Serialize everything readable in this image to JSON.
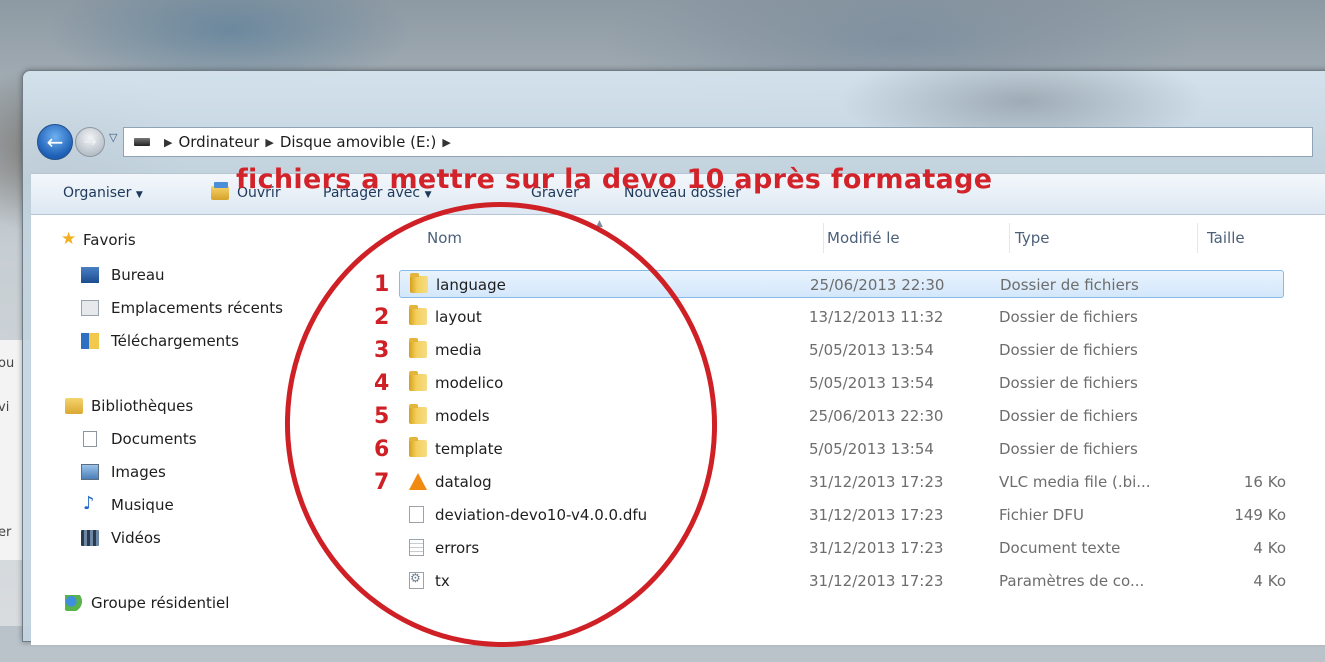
{
  "address_bar": {
    "breadcrumbs": [
      "Ordinateur",
      "Disque amovible (E:)"
    ]
  },
  "toolbar": {
    "organize": "Organiser",
    "open": "Ouvrir",
    "share": "Partager avec",
    "burn": "Graver",
    "new_folder": "Nouveau dossier"
  },
  "annotation": {
    "title": "fichiers a mettre sur la devo 10 après formatage",
    "numbers": [
      "1",
      "2",
      "3",
      "4",
      "5",
      "6",
      "7"
    ],
    "color": "#d2232a"
  },
  "behind_window": [
    "ou",
    "vi",
    "er"
  ],
  "sidebar": {
    "favorites": {
      "label": "Favoris",
      "items": [
        "Bureau",
        "Emplacements récents",
        "Téléchargements"
      ]
    },
    "libraries": {
      "label": "Bibliothèques",
      "items": [
        "Documents",
        "Images",
        "Musique",
        "Vidéos"
      ]
    },
    "homegroup": "Groupe résidentiel"
  },
  "columns": {
    "name": "Nom",
    "modified": "Modifié le",
    "type": "Type",
    "size": "Taille"
  },
  "files": [
    {
      "name": "language",
      "date": "25/06/2013 22:30",
      "type": "Dossier de fichiers",
      "size": "",
      "icon": "folder-icon",
      "selected": true
    },
    {
      "name": "layout",
      "date": "13/12/2013 11:32",
      "type": "Dossier de fichiers",
      "size": "",
      "icon": "folder-icon"
    },
    {
      "name": "media",
      "date": "5/05/2013 13:54",
      "type": "Dossier de fichiers",
      "size": "",
      "icon": "folder-icon"
    },
    {
      "name": "modelico",
      "date": "5/05/2013 13:54",
      "type": "Dossier de fichiers",
      "size": "",
      "icon": "folder-icon"
    },
    {
      "name": "models",
      "date": "25/06/2013 22:30",
      "type": "Dossier de fichiers",
      "size": "",
      "icon": "folder-icon"
    },
    {
      "name": "template",
      "date": "5/05/2013 13:54",
      "type": "Dossier de fichiers",
      "size": "",
      "icon": "folder-icon"
    },
    {
      "name": "datalog",
      "date": "31/12/2013 17:23",
      "type": "VLC media file (.bi...",
      "size": "16 Ko",
      "icon": "vlc-icon"
    },
    {
      "name": "deviation-devo10-v4.0.0.dfu",
      "date": "31/12/2013 17:23",
      "type": "Fichier DFU",
      "size": "149 Ko",
      "icon": "document-icon"
    },
    {
      "name": "errors",
      "date": "31/12/2013 17:23",
      "type": "Document texte",
      "size": "4 Ko",
      "icon": "text-document-icon"
    },
    {
      "name": "tx",
      "date": "31/12/2013 17:23",
      "type": "Paramètres de co...",
      "size": "4 Ko",
      "icon": "settings-file-icon"
    }
  ]
}
